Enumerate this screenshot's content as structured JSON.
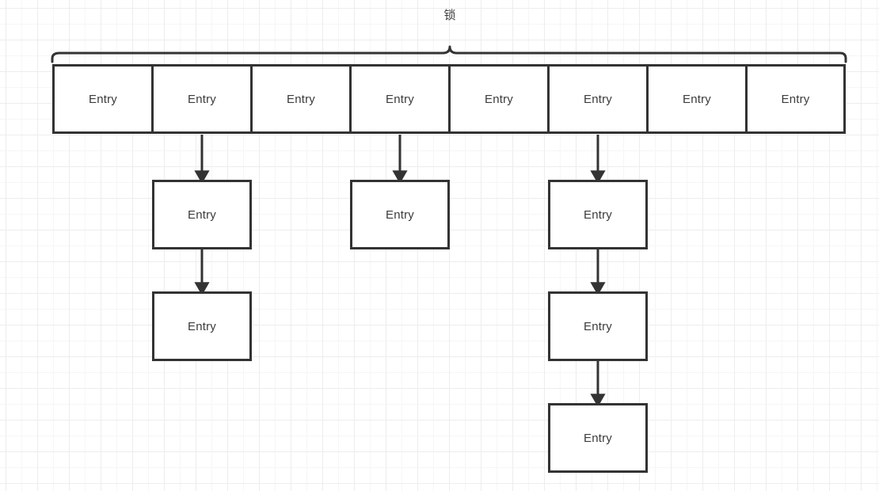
{
  "diagram": {
    "title_label": "锁",
    "entry_label": "Entry",
    "colors": {
      "stroke": "#333333",
      "text": "#3b3b3b",
      "background": "#ffffff",
      "grid_minor": "#f6f6f6",
      "grid_major": "#ededed"
    },
    "bucket_array": {
      "label": "锁",
      "cells": [
        {
          "label": "Entry"
        },
        {
          "label": "Entry"
        },
        {
          "label": "Entry"
        },
        {
          "label": "Entry"
        },
        {
          "label": "Entry"
        },
        {
          "label": "Entry"
        },
        {
          "label": "Entry"
        },
        {
          "label": "Entry"
        }
      ]
    },
    "chains": [
      {
        "bucket_index": 1,
        "nodes": [
          {
            "label": "Entry"
          },
          {
            "label": "Entry"
          }
        ]
      },
      {
        "bucket_index": 3,
        "nodes": [
          {
            "label": "Entry"
          }
        ]
      },
      {
        "bucket_index": 5,
        "nodes": [
          {
            "label": "Entry"
          },
          {
            "label": "Entry"
          },
          {
            "label": "Entry"
          }
        ]
      }
    ]
  }
}
